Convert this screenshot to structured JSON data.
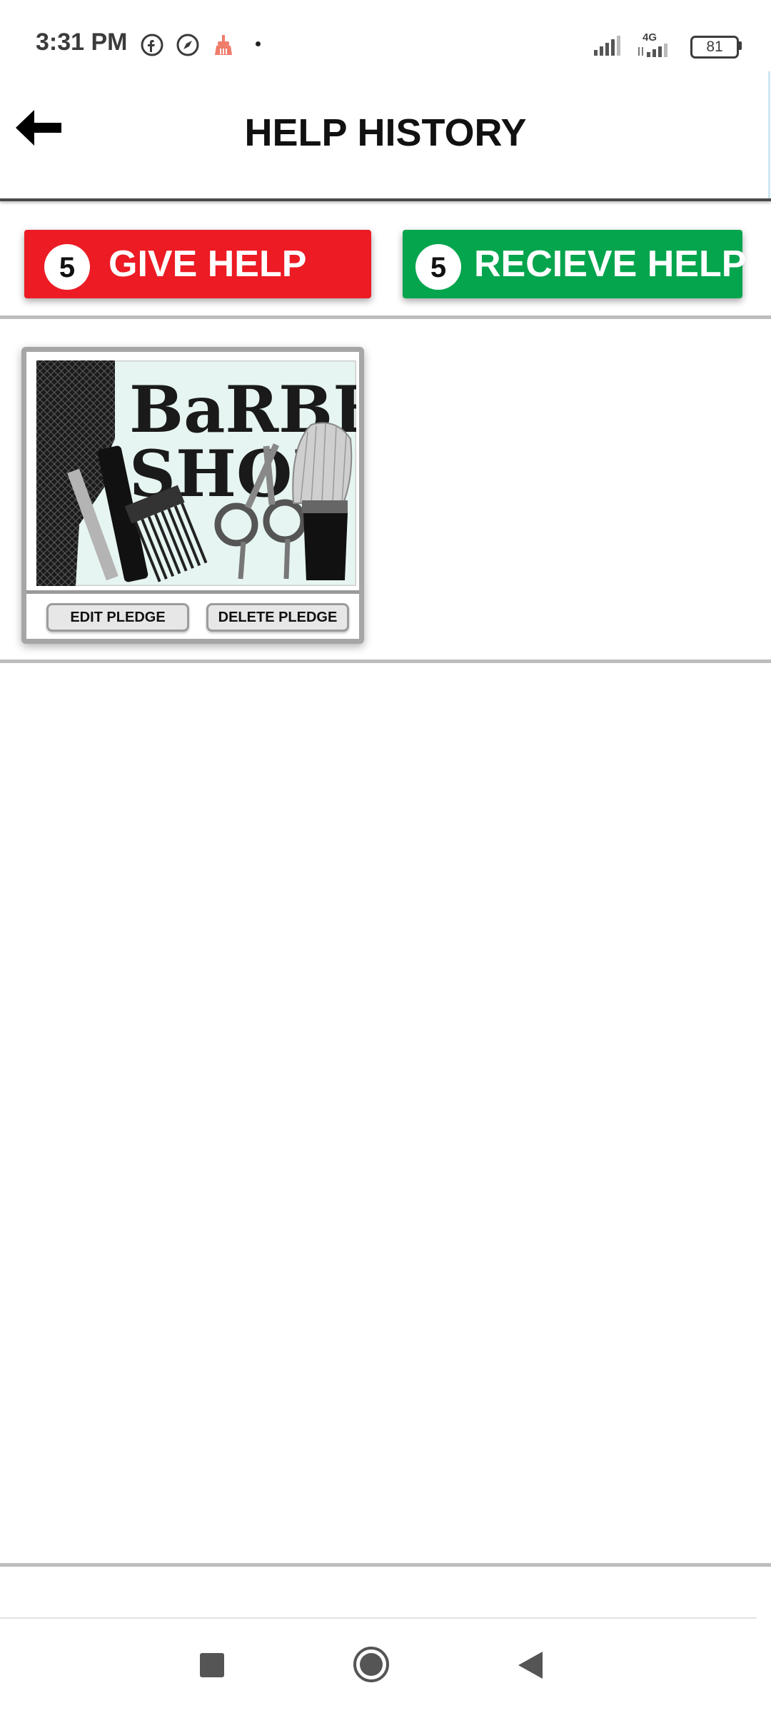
{
  "status_bar": {
    "time": "3:31 PM",
    "network_type": "4G",
    "battery_level": "81"
  },
  "header": {
    "title": "HELP HISTORY"
  },
  "tabs": {
    "give_help": {
      "count": "5",
      "label": "GIVE HELP",
      "color": "#ec1b24"
    },
    "receive_help": {
      "count": "5",
      "label": "RECIEVE HELP",
      "color": "#04a54d"
    }
  },
  "pledges": [
    {
      "image_text_line1": "BaRBER",
      "image_text_line2": "SHOP",
      "edit_label": "EDIT PLEDGE",
      "delete_label": "DELETE PLEDGE"
    }
  ],
  "icons": {
    "status": [
      "facebook-icon",
      "compass-icon",
      "cleaner-broom-icon"
    ],
    "navigation": [
      "recents-square-icon",
      "home-circle-icon",
      "back-triangle-icon"
    ]
  }
}
